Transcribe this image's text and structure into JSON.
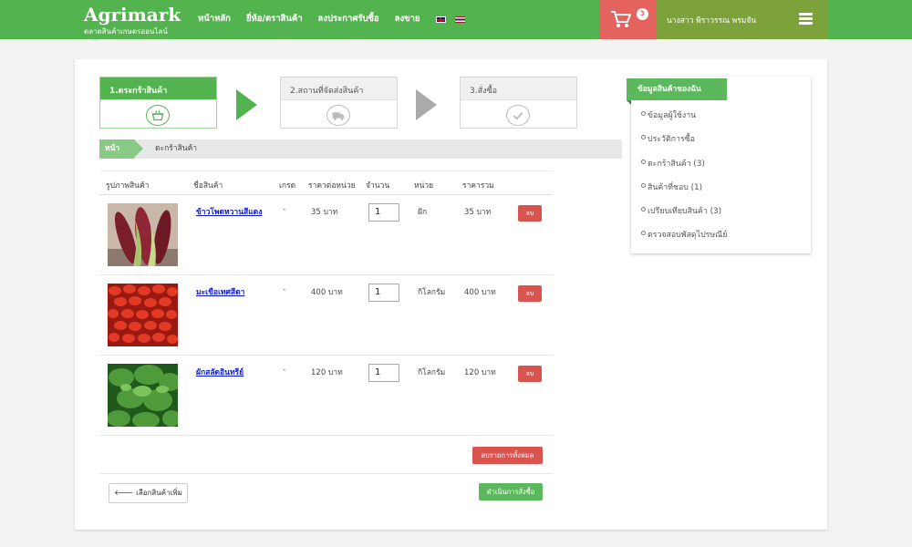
{
  "header": {
    "logo": "Agrimark",
    "logo_sub": "ตลาดสินค้าเกษตรออนไลน์",
    "nav": [
      "หน้าหลัก",
      "ยี่ห้อ/ตราสินค้า",
      "ลงประกาศรับซื้อ",
      "ลงขาย"
    ],
    "cart_count": "3",
    "user_name": "นางสาว พิราวรรณ พรมจัน"
  },
  "steps": [
    {
      "label": "1.ตระกร้าสินค้า"
    },
    {
      "label": "2.สถานที่จัดส่งสินค้า"
    },
    {
      "label": "3.สั่งซื้อ"
    }
  ],
  "breadcrumb": {
    "home": "หน้าหลัก",
    "current": "ตะกร้าสินค้า"
  },
  "table": {
    "headers": [
      "รูปภาพสินค้า",
      "ชื่อสินค้า",
      "เกรด",
      "ราคาต่อหน่วย",
      "จำนวน",
      "หน่วย",
      "ราคารวม"
    ],
    "rows": [
      {
        "name": "ข้าวโพดหวานสีแดง",
        "grade": "-",
        "unit_price": "35 บาท",
        "qty": "1",
        "unit": "ฝัก",
        "total": "35 บาท",
        "delete": "ลบ"
      },
      {
        "name": "มะเขือเทศสีดา",
        "grade": "-",
        "unit_price": "400 บาท",
        "qty": "1",
        "unit": "กิโลกรัม",
        "total": "400 บาท",
        "delete": "ลบ"
      },
      {
        "name": "ผักสลัดอินทรีย์",
        "grade": "-",
        "unit_price": "120 บาท",
        "qty": "1",
        "unit": "กิโลกรัม",
        "total": "120 บาท",
        "delete": "ลบ"
      }
    ],
    "delete_all": "ลบรายการทั้งหมด",
    "back_button": "เลือกสินค้าเพิ่ม",
    "proceed_button": "ดำเนินการสั่งซื้อ"
  },
  "side": {
    "title": "ข้อมูลสินค้าของฉัน",
    "items": [
      "ข้อมูลผู้ใช้งาน",
      "ประวัติการซื้อ",
      "ตะกร้าสินค้า (3)",
      "สินค้าที่ชอบ (1)",
      "เปรียบเทียบสินค้า (3)",
      "ตรวจสอบพัสดุไปรษณีย์"
    ]
  }
}
